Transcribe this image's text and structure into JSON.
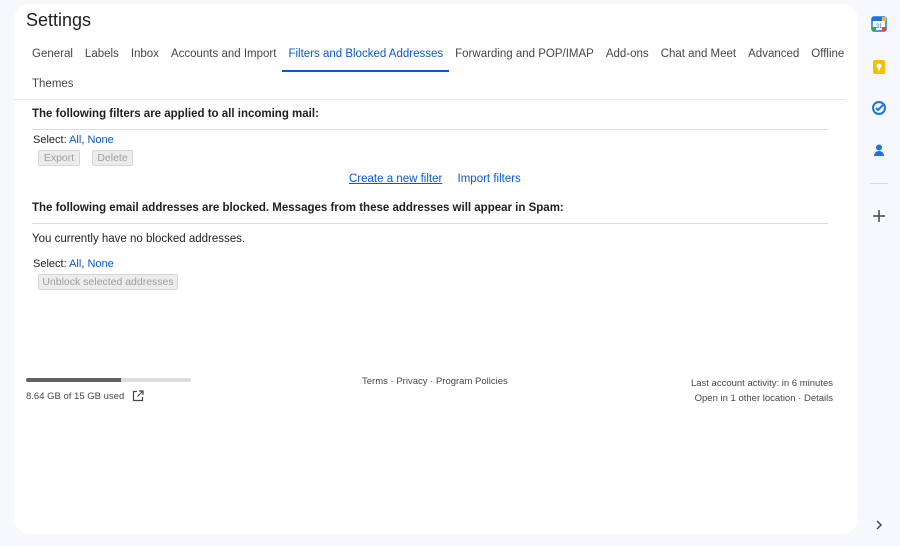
{
  "title": "Settings",
  "tabs": [
    {
      "label": "General"
    },
    {
      "label": "Labels"
    },
    {
      "label": "Inbox"
    },
    {
      "label": "Accounts and Import"
    },
    {
      "label": "Filters and Blocked Addresses",
      "active": true
    },
    {
      "label": "Forwarding and POP/IMAP"
    },
    {
      "label": "Add-ons"
    },
    {
      "label": "Chat and Meet"
    },
    {
      "label": "Advanced"
    },
    {
      "label": "Offline"
    },
    {
      "label": "Themes"
    }
  ],
  "filters": {
    "heading": "The following filters are applied to all incoming mail:",
    "select_label": "Select:",
    "select_all": "All",
    "comma": ",",
    "select_none": "None",
    "export_label": "Export",
    "delete_label": "Delete",
    "create_link": "Create a new filter",
    "import_link": "Import filters"
  },
  "blocked": {
    "heading": "The following email addresses are blocked. Messages from these addresses will appear in Spam:",
    "empty_text": "You currently have no blocked addresses.",
    "select_label": "Select:",
    "select_all": "All",
    "comma": ",",
    "select_none": "None",
    "unblock_label": "Unblock selected addresses"
  },
  "footer": {
    "storage_text": "8.64 GB of 15 GB used",
    "storage_fraction": 0.576,
    "terms": "Terms",
    "dot": "·",
    "privacy": "Privacy",
    "policies": "Program Policies",
    "activity": "Last account activity: in 6 minutes",
    "open_location": "Open in 1 other location",
    "details": "Details"
  },
  "side_rail": {
    "icons": [
      "calendar-icon",
      "keep-icon",
      "tasks-icon",
      "contacts-icon",
      "add-icon",
      "chevron-right-icon"
    ],
    "colors": {
      "calendar": "#1a73e8",
      "keep": "#fbbc04",
      "tasks": "#1a73e8",
      "contacts": "#1a73e8"
    }
  },
  "accent": "#0b57d0"
}
